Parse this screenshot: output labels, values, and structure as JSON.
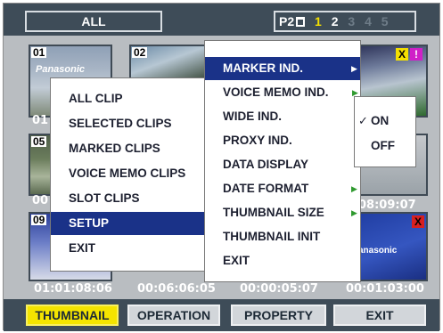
{
  "top_bar": {
    "all_label": "ALL",
    "p2_label": "P2",
    "slots": [
      "1",
      "2",
      "3",
      "4",
      "5"
    ]
  },
  "thumbnails": [
    {
      "number": "01",
      "caption": "Panasonic"
    },
    {
      "number": "02"
    },
    {
      "number": "05"
    },
    {
      "number": "09"
    },
    {
      "caption": "anasonic"
    }
  ],
  "timecodes": {
    "row1": "01",
    "row2": "00",
    "row2_right": "08:09:07",
    "row3": [
      "01:01:08:06",
      "00:06:06:05",
      "00:00:05:07",
      "00:01:03:00"
    ]
  },
  "badges": {
    "x_yellow": "X",
    "exclaim": "!",
    "x_red": "X"
  },
  "menu_left": {
    "items": [
      "ALL CLIP",
      "SELECTED CLIPS",
      "MARKED CLIPS",
      "VOICE MEMO CLIPS",
      "SLOT CLIPS",
      "SETUP",
      "EXIT"
    ],
    "selected": "SETUP"
  },
  "menu_setup": {
    "items": [
      "MARKER IND.",
      "VOICE MEMO IND.",
      "WIDE IND.",
      "PROXY IND.",
      "DATA DISPLAY",
      "DATE FORMAT",
      "THUMBNAIL SIZE",
      "THUMBNAIL INIT",
      "EXIT"
    ],
    "selected": "MARKER IND."
  },
  "menu_onoff": {
    "items": [
      "ON",
      "OFF"
    ],
    "checked": "ON",
    "check_mark": "✓"
  },
  "bottom_bar": {
    "thumbnail": "THUMBNAIL",
    "operation": "OPERATION",
    "property": "PROPERTY",
    "exit": "EXIT"
  },
  "colors": {
    "bar": "#3e4c58",
    "highlight": "#1a3288",
    "active_tab": "#f4e400",
    "slot_active": "#f4e000",
    "arrow": "#2f9a2f"
  }
}
